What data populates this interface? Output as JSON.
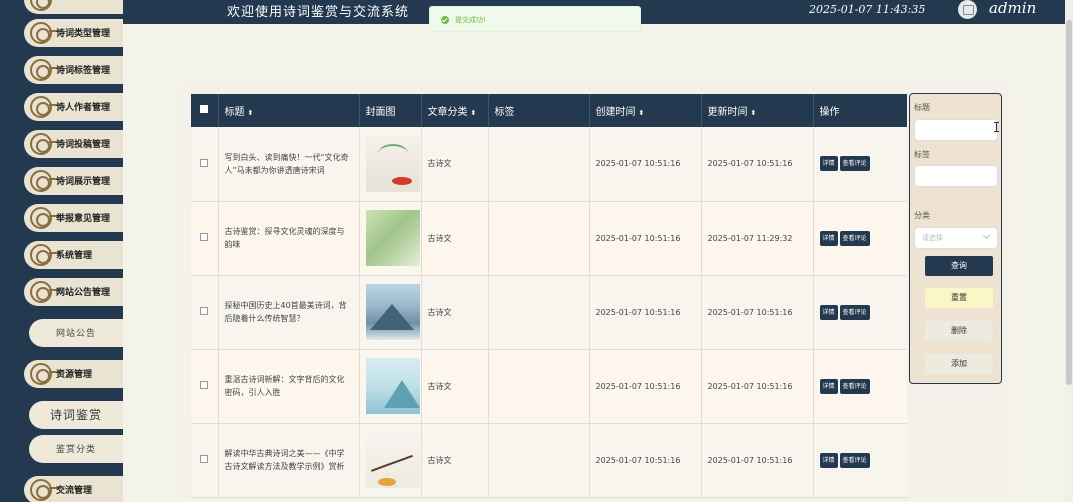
{
  "header": {
    "title": "欢迎使用诗词鉴赏与交流系统",
    "datetime": "2025-01-07 11:43:35",
    "username": "admin"
  },
  "toast": {
    "message": "提交成功!"
  },
  "sidebar": {
    "items": [
      {
        "label": "诗词类型管理"
      },
      {
        "label": "诗词标签管理"
      },
      {
        "label": "诗人作者管理"
      },
      {
        "label": "诗词投稿管理"
      },
      {
        "label": "诗词展示管理"
      },
      {
        "label": "举报意见管理"
      },
      {
        "label": "系统管理"
      },
      {
        "label": "网站公告管理"
      },
      {
        "label": "网站公告"
      },
      {
        "label": "资源管理"
      },
      {
        "label": "诗词鉴赏"
      },
      {
        "label": "鉴赏分类"
      },
      {
        "label": "交流管理"
      }
    ]
  },
  "table": {
    "headers": [
      "标题",
      "封面图",
      "文章分类",
      "标签",
      "创建时间",
      "更新时间",
      "操作"
    ],
    "sort_icon": "⬍",
    "rows": [
      {
        "title": "写到白头、读到痛快！一代“文化奇人”马未都为你讲透唐诗宋词",
        "category": "古诗文",
        "tag": "",
        "created": "2025-01-07 10:51:16",
        "updated": "2025-01-07 10:51:16"
      },
      {
        "title": "古诗鉴赏：探寻文化灵魂的深度与韵味",
        "category": "古诗文",
        "tag": "",
        "created": "2025-01-07 10:51:16",
        "updated": "2025-01-07 11:29:32"
      },
      {
        "title": "探秘中国历史上40首最美诗词，背后隐着什么传统智慧？",
        "category": "古诗文",
        "tag": "",
        "created": "2025-01-07 10:51:16",
        "updated": "2025-01-07 10:51:16"
      },
      {
        "title": "重温古诗词新解：文字背后的文化密码，引人入胜",
        "category": "古诗文",
        "tag": "",
        "created": "2025-01-07 10:51:16",
        "updated": "2025-01-07 10:51:16"
      },
      {
        "title": "解读中华古典诗词之美——《中学古诗文解读方法及教学示例》赏析",
        "category": "古诗文",
        "tag": "",
        "created": "2025-01-07 10:51:16",
        "updated": "2025-01-07 10:51:16"
      }
    ],
    "actions": {
      "detail": "详情",
      "comments": "查看评论"
    }
  },
  "search_form": {
    "title_label": "标题",
    "tag_label": "标签",
    "category_label": "分类",
    "category_placeholder": "请选择",
    "query_button": "查询",
    "reset_button": "重置",
    "delete_button": "删除",
    "add_button": "添加"
  }
}
